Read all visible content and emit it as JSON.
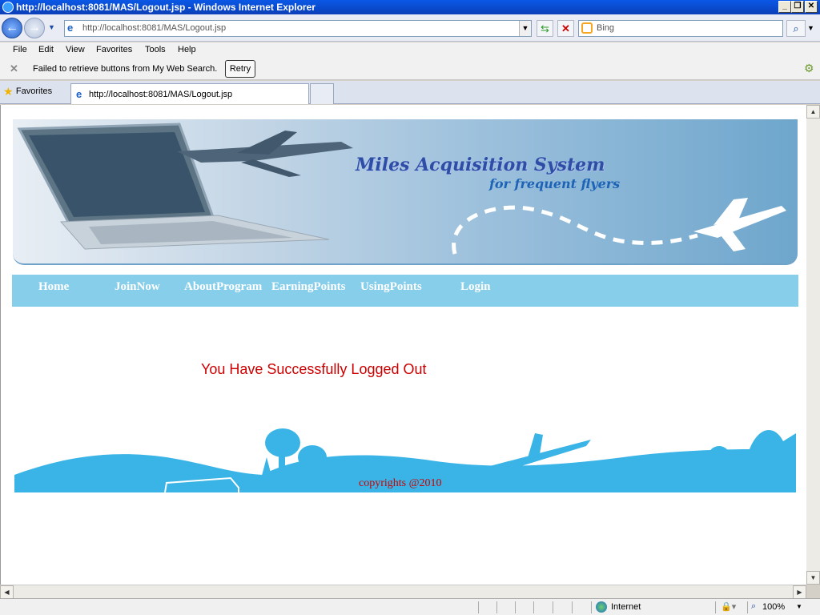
{
  "window": {
    "title": "http://localhost:8081/MAS/Logout.jsp - Windows Internet Explorer"
  },
  "address": {
    "url": "http://localhost:8081/MAS/Logout.jsp"
  },
  "search": {
    "placeholder": "Bing"
  },
  "menu": {
    "items": [
      "File",
      "Edit",
      "View",
      "Favorites",
      "Tools",
      "Help"
    ]
  },
  "infobar": {
    "message": "Failed to retrieve buttons from My Web Search.",
    "retry_label": "Retry"
  },
  "favorites": {
    "label": "Favorites"
  },
  "tabs": [
    {
      "label": "http://localhost:8081/MAS/Logout.jsp"
    }
  ],
  "page": {
    "banner_title": "Miles Acquisition System",
    "banner_subtitle": "for frequent flyers",
    "nav": [
      "Home",
      "JoinNow",
      "AboutProgram",
      "EarningPoints",
      "UsingPoints",
      "Login"
    ],
    "message": "You Have Successfully Logged Out",
    "copyright": "copyrights @2010"
  },
  "status": {
    "zone": "Internet",
    "zoom": "100%"
  },
  "colors": {
    "nav_bg": "#87ceeb",
    "message": "#cc0000",
    "footer_scene": "#3ab4e6"
  }
}
